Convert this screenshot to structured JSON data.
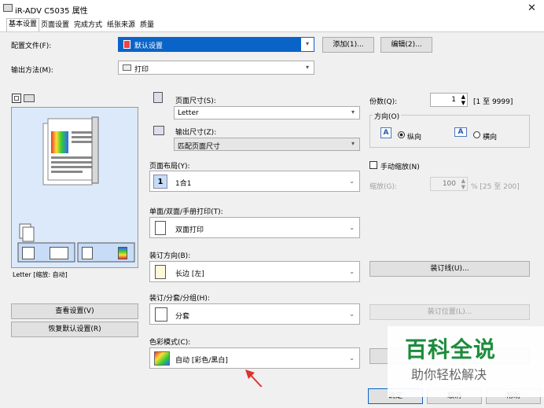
{
  "window": {
    "title": "iR-ADV C5035 属性",
    "close_glyph": "✕"
  },
  "tabs": [
    "基本设置",
    "页面设置",
    "完成方式",
    "纸张来源",
    "质量"
  ],
  "config_file": {
    "label": "配置文件(F):",
    "value": "默认设置",
    "add_button": "添加(1)...",
    "edit_button": "编辑(2)..."
  },
  "output_method": {
    "label": "输出方法(M):",
    "value": "打印"
  },
  "preview": {
    "caption": "Letter [缩放: 自动]"
  },
  "page_size": {
    "label": "页面尺寸(S):",
    "value": "Letter"
  },
  "output_size": {
    "label": "输出尺寸(Z):",
    "value": "匹配页面尺寸"
  },
  "page_layout": {
    "label": "页面布局(Y):",
    "value": "1合1",
    "badge": "1"
  },
  "duplex": {
    "label": "单面/双面/手册打印(T):",
    "value": "双面打印"
  },
  "binding": {
    "label": "装订方向(B):",
    "value": "长边 [左]",
    "button": "装订线(U)..."
  },
  "finishing": {
    "label": "装订/分套/分组(H):",
    "value": "分套",
    "button": "装订位置(L)..."
  },
  "color_mode": {
    "label": "色彩模式(C):",
    "value": "自动 [彩色/黑白]"
  },
  "copies": {
    "label": "份数(Q):",
    "value": "1",
    "range": "[1 至 9999]"
  },
  "orientation": {
    "label": "方向(O)",
    "portrait": "纵向",
    "landscape": "横向",
    "selected": "纵向"
  },
  "manual_scale": {
    "label": "手动缩放(N)",
    "checked": false
  },
  "scaling": {
    "label": "缩放(G):",
    "value": "100",
    "range": "% [25 至 200]"
  },
  "left_buttons": {
    "view_settings": "查看设置(V)",
    "restore_default": "恢复默认设置(R)"
  },
  "bottom_buttons": {
    "ok": "确定",
    "cancel": "取消",
    "help": "帮助"
  },
  "watermark": {
    "title": "百科全说",
    "subtitle": "助你轻松解决"
  },
  "colors": {
    "accent": "#0a64c8",
    "watermark_green": "#1b8c3c",
    "arrow_red": "#e0322d"
  }
}
